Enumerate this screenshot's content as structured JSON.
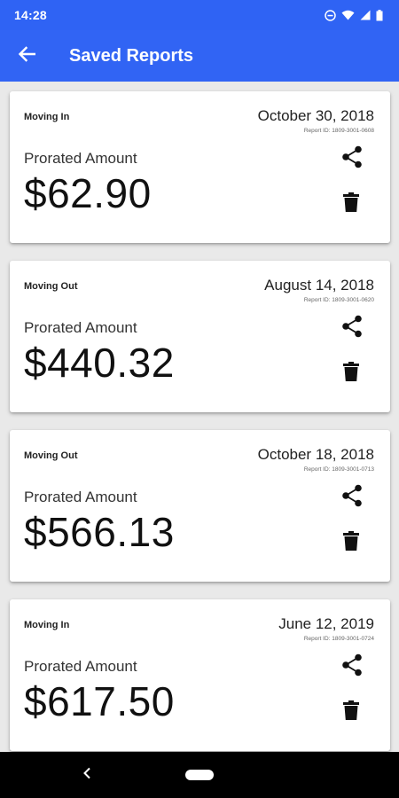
{
  "status_bar": {
    "time": "14:28"
  },
  "app_bar": {
    "title": "Saved Reports",
    "back_icon": "arrow-back-icon"
  },
  "colors": {
    "primary": "#3164f4",
    "background": "#e9e9e9",
    "card": "#ffffff",
    "nav_bar": "#000000"
  },
  "reports": [
    {
      "type": "Moving In",
      "date": "October 30, 2018",
      "report_id": "Report ID: 1809-3001-0608",
      "label": "Prorated Amount",
      "amount": "$62.90"
    },
    {
      "type": "Moving Out",
      "date": "August 14, 2018",
      "report_id": "Report ID: 1809-3001-0620",
      "label": "Prorated Amount",
      "amount": "$440.32"
    },
    {
      "type": "Moving Out",
      "date": "October 18, 2018",
      "report_id": "Report ID: 1809-3001-0713",
      "label": "Prorated Amount",
      "amount": "$566.13"
    },
    {
      "type": "Moving In",
      "date": "June 12, 2019",
      "report_id": "Report ID: 1809-3001-0724",
      "label": "Prorated Amount",
      "amount": "$617.50"
    }
  ]
}
